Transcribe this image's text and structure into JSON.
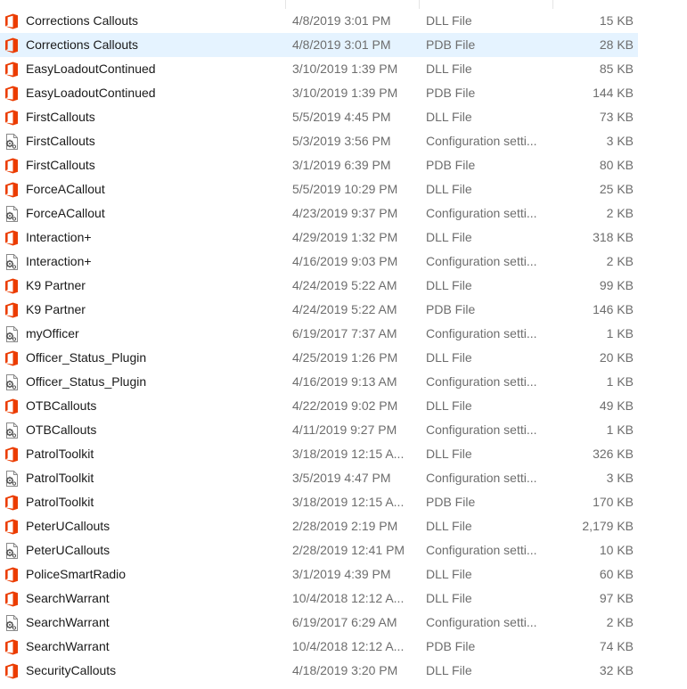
{
  "files": [
    {
      "name": "Corrections Callouts",
      "date": "4/8/2019 3:01 PM",
      "type": "DLL File",
      "size": "15 KB",
      "icon": "office-icon"
    },
    {
      "name": "Corrections Callouts",
      "date": "4/8/2019 3:01 PM",
      "type": "PDB File",
      "size": "28 KB",
      "icon": "office-icon",
      "selected": true
    },
    {
      "name": "EasyLoadoutContinued",
      "date": "3/10/2019 1:39 PM",
      "type": "DLL File",
      "size": "85 KB",
      "icon": "office-icon"
    },
    {
      "name": "EasyLoadoutContinued",
      "date": "3/10/2019 1:39 PM",
      "type": "PDB File",
      "size": "144 KB",
      "icon": "office-icon"
    },
    {
      "name": "FirstCallouts",
      "date": "5/5/2019 4:45 PM",
      "type": "DLL File",
      "size": "73 KB",
      "icon": "office-icon"
    },
    {
      "name": "FirstCallouts",
      "date": "5/3/2019 3:56 PM",
      "type": "Configuration setti...",
      "size": "3 KB",
      "icon": "config-file-icon"
    },
    {
      "name": "FirstCallouts",
      "date": "3/1/2019 6:39 PM",
      "type": "PDB File",
      "size": "80 KB",
      "icon": "office-icon"
    },
    {
      "name": "ForceACallout",
      "date": "5/5/2019 10:29 PM",
      "type": "DLL File",
      "size": "25 KB",
      "icon": "office-icon"
    },
    {
      "name": "ForceACallout",
      "date": "4/23/2019 9:37 PM",
      "type": "Configuration setti...",
      "size": "2 KB",
      "icon": "config-file-icon"
    },
    {
      "name": "Interaction+",
      "date": "4/29/2019 1:32 PM",
      "type": "DLL File",
      "size": "318 KB",
      "icon": "office-icon"
    },
    {
      "name": "Interaction+",
      "date": "4/16/2019 9:03 PM",
      "type": "Configuration setti...",
      "size": "2 KB",
      "icon": "config-file-icon"
    },
    {
      "name": "K9 Partner",
      "date": "4/24/2019 5:22 AM",
      "type": "DLL File",
      "size": "99 KB",
      "icon": "office-icon"
    },
    {
      "name": "K9 Partner",
      "date": "4/24/2019 5:22 AM",
      "type": "PDB File",
      "size": "146 KB",
      "icon": "office-icon"
    },
    {
      "name": "myOfficer",
      "date": "6/19/2017 7:37 AM",
      "type": "Configuration setti...",
      "size": "1 KB",
      "icon": "config-file-icon"
    },
    {
      "name": "Officer_Status_Plugin",
      "date": "4/25/2019 1:26 PM",
      "type": "DLL File",
      "size": "20 KB",
      "icon": "office-icon"
    },
    {
      "name": "Officer_Status_Plugin",
      "date": "4/16/2019 9:13 AM",
      "type": "Configuration setti...",
      "size": "1 KB",
      "icon": "config-file-icon"
    },
    {
      "name": "OTBCallouts",
      "date": "4/22/2019 9:02 PM",
      "type": "DLL File",
      "size": "49 KB",
      "icon": "office-icon"
    },
    {
      "name": "OTBCallouts",
      "date": "4/11/2019 9:27 PM",
      "type": "Configuration setti...",
      "size": "1 KB",
      "icon": "config-file-icon"
    },
    {
      "name": "PatrolToolkit",
      "date": "3/18/2019 12:15 A...",
      "type": "DLL File",
      "size": "326 KB",
      "icon": "office-icon"
    },
    {
      "name": "PatrolToolkit",
      "date": "3/5/2019 4:47 PM",
      "type": "Configuration setti...",
      "size": "3 KB",
      "icon": "config-file-icon"
    },
    {
      "name": "PatrolToolkit",
      "date": "3/18/2019 12:15 A...",
      "type": "PDB File",
      "size": "170 KB",
      "icon": "office-icon"
    },
    {
      "name": "PeterUCallouts",
      "date": "2/28/2019 2:19 PM",
      "type": "DLL File",
      "size": "2,179 KB",
      "icon": "office-icon"
    },
    {
      "name": "PeterUCallouts",
      "date": "2/28/2019 12:41 PM",
      "type": "Configuration setti...",
      "size": "10 KB",
      "icon": "config-file-icon"
    },
    {
      "name": "PoliceSmartRadio",
      "date": "3/1/2019 4:39 PM",
      "type": "DLL File",
      "size": "60 KB",
      "icon": "office-icon"
    },
    {
      "name": "SearchWarrant",
      "date": "10/4/2018 12:12 A...",
      "type": "DLL File",
      "size": "97 KB",
      "icon": "office-icon"
    },
    {
      "name": "SearchWarrant",
      "date": "6/19/2017 6:29 AM",
      "type": "Configuration setti...",
      "size": "2 KB",
      "icon": "config-file-icon"
    },
    {
      "name": "SearchWarrant",
      "date": "10/4/2018 12:12 A...",
      "type": "PDB File",
      "size": "74 KB",
      "icon": "office-icon"
    },
    {
      "name": "SecurityCallouts",
      "date": "4/18/2019 3:20 PM",
      "type": "DLL File",
      "size": "32 KB",
      "icon": "office-icon"
    }
  ],
  "colors": {
    "office_orange": "#eb3c00",
    "selection_bg": "#e5f3ff",
    "secondary_text": "#6d6d6d"
  }
}
